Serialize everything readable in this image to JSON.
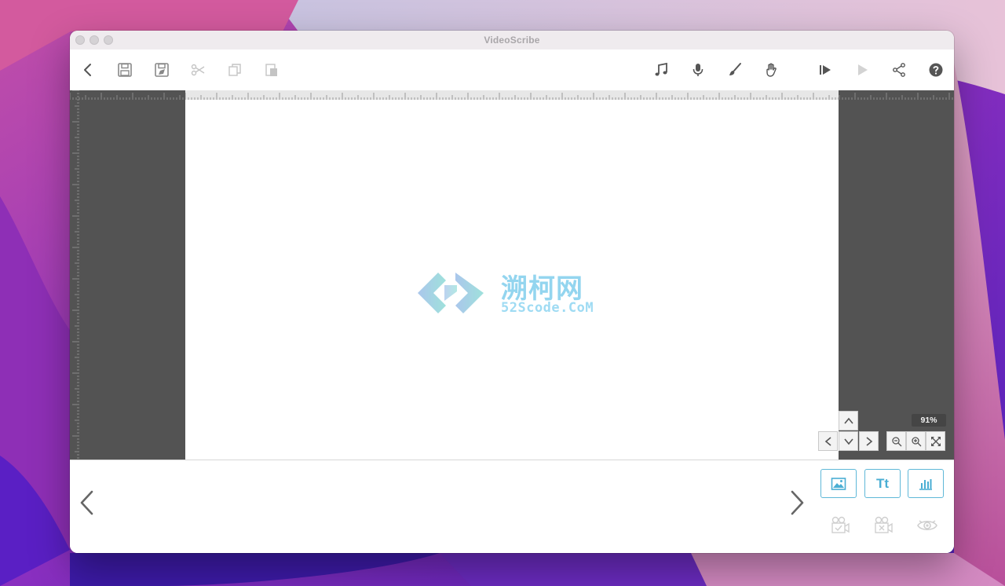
{
  "window": {
    "title": "VideoScribe"
  },
  "toolbar": {
    "left": [
      {
        "name": "back-button",
        "icon": "chevron-left-icon"
      },
      {
        "name": "save-button",
        "icon": "floppy-disk-icon"
      },
      {
        "name": "save-as-button",
        "icon": "floppy-disk-edit-icon"
      },
      {
        "name": "cut-button",
        "icon": "scissors-icon"
      },
      {
        "name": "copy-button",
        "icon": "copy-icon"
      },
      {
        "name": "paste-button",
        "icon": "paste-icon"
      }
    ],
    "right": [
      {
        "name": "music-button",
        "icon": "music-note-icon"
      },
      {
        "name": "voiceover-button",
        "icon": "microphone-icon"
      },
      {
        "name": "brush-button",
        "icon": "paintbrush-icon"
      },
      {
        "name": "hand-button",
        "icon": "hand-icon"
      },
      {
        "name": "preview-from-button",
        "icon": "play-from-icon"
      },
      {
        "name": "play-button",
        "icon": "play-icon"
      },
      {
        "name": "share-button",
        "icon": "share-icon"
      },
      {
        "name": "help-button",
        "icon": "question-mark-icon"
      }
    ]
  },
  "canvas": {
    "zoom_label": "91%",
    "watermark": {
      "cn_text": "溯柯网",
      "en_text": "52Scode.CoM"
    }
  },
  "colors": {
    "stage_bg": "#535353",
    "accent": "#4aaed3",
    "icon_active": "#555555",
    "icon_disabled": "#c4c4c4"
  },
  "bottom": {
    "add_text_label": "Tt",
    "buttons": [
      {
        "name": "add-image-button",
        "icon": "image-icon"
      },
      {
        "name": "add-text-button",
        "icon": "text-icon"
      },
      {
        "name": "add-chart-button",
        "icon": "bar-chart-icon"
      },
      {
        "name": "camera-set-button",
        "icon": "camera-check-icon"
      },
      {
        "name": "camera-clear-button",
        "icon": "camera-x-icon"
      },
      {
        "name": "visibility-button",
        "icon": "eye-icon"
      }
    ]
  }
}
